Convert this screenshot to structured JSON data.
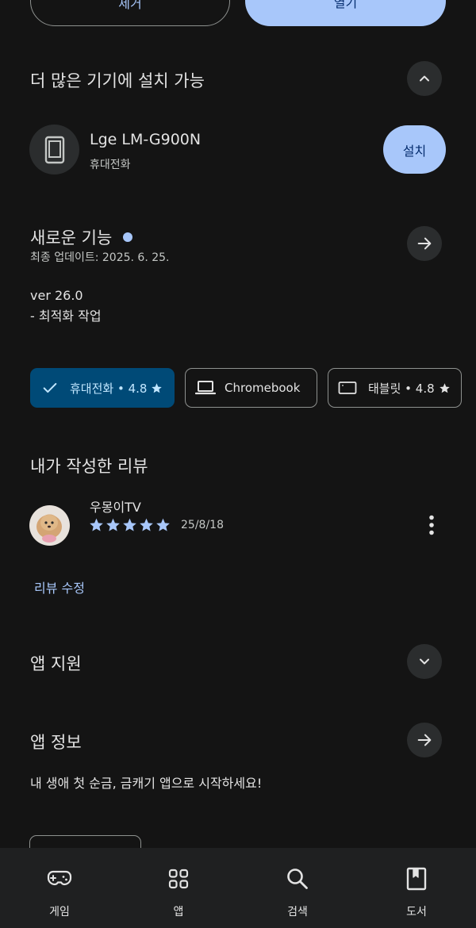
{
  "top_buttons": {
    "remove_label": "제거",
    "open_label": "열기"
  },
  "more_devices": {
    "title": "더 많은 기기에 설치 가능",
    "device": {
      "name": "Lge LM-G900N",
      "type": "휴대전화",
      "install_label": "설치"
    }
  },
  "whats_new": {
    "title": "새로운 기능",
    "updated": "최종 업데이트: 2025. 6. 25.",
    "notes_line1": "ver 26.0",
    "notes_line2": "- 최적화 작업"
  },
  "device_chips": [
    {
      "label": "휴대전화 • 4.8",
      "selected": true
    },
    {
      "label": "Chromebook",
      "selected": false
    },
    {
      "label": "태블릿 • 4.8",
      "selected": false
    }
  ],
  "my_review": {
    "title": "내가 작성한 리뷰",
    "reviewer": "우몽이TV",
    "rating": 5,
    "date": "25/8/18",
    "edit_label": "리뷰 수정"
  },
  "app_support": {
    "title": "앱 지원"
  },
  "app_info": {
    "title": "앱 정보",
    "description": "내 생애 첫 순금, 금캐기 앱으로 시작하세요!"
  },
  "bottom_nav": [
    {
      "label": "게임",
      "icon": "gamepad-icon"
    },
    {
      "label": "앱",
      "icon": "apps-grid-icon"
    },
    {
      "label": "검색",
      "icon": "search-icon"
    },
    {
      "label": "도서",
      "icon": "book-icon"
    }
  ],
  "colors": {
    "accent": "#a8c7fa",
    "selected_chip": "#004a77",
    "background": "#141414"
  }
}
